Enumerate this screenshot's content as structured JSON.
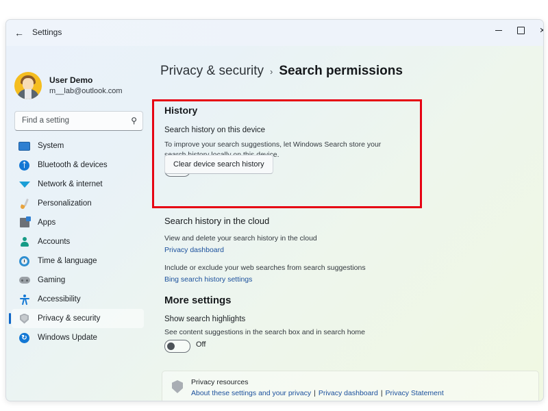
{
  "titlebar": {
    "back_icon": "back-arrow-icon",
    "title": "Settings",
    "minimize_label": "Minimize",
    "maximize_label": "Maximize",
    "close_label": "✕"
  },
  "account": {
    "name": "User Demo",
    "email": "m__lab@outlook.com",
    "avatar_icon": "user-avatar"
  },
  "search": {
    "placeholder": "Find a setting",
    "value": "",
    "icon": "search-icon"
  },
  "sidebar": {
    "items": [
      {
        "label": "System",
        "icon": "monitor-icon",
        "selected": false
      },
      {
        "label": "Bluetooth & devices",
        "icon": "bluetooth-icon",
        "selected": false
      },
      {
        "label": "Network & internet",
        "icon": "wifi-icon",
        "selected": false
      },
      {
        "label": "Personalization",
        "icon": "paintbrush-icon",
        "selected": false
      },
      {
        "label": "Apps",
        "icon": "apps-grid-icon",
        "selected": false
      },
      {
        "label": "Accounts",
        "icon": "person-icon",
        "selected": false
      },
      {
        "label": "Time & language",
        "icon": "clock-icon",
        "selected": false
      },
      {
        "label": "Gaming",
        "icon": "gamepad-icon",
        "selected": false
      },
      {
        "label": "Accessibility",
        "icon": "accessibility-icon",
        "selected": false
      },
      {
        "label": "Privacy & security",
        "icon": "shield-icon",
        "selected": true
      },
      {
        "label": "Windows Update",
        "icon": "update-icon",
        "selected": false
      }
    ]
  },
  "breadcrumb": {
    "parent": "Privacy & security",
    "separator": "›",
    "current": "Search permissions"
  },
  "history_section": {
    "heading": "History",
    "row_title": "Search history on this device",
    "row_description": "To improve your search suggestions, let Windows Search store your search history locally on this device.",
    "toggle_state": "Off",
    "clear_button": "Clear device search history",
    "highlight_color": "#e60012"
  },
  "cloud_section": {
    "heading": "Search history in the cloud",
    "description_1": "View and delete your search history in the cloud",
    "link_1": "Privacy dashboard",
    "description_2": "Include or exclude your web searches from search suggestions",
    "link_2": "Bing search history settings"
  },
  "more_settings": {
    "heading": "More settings",
    "row_title": "Show search highlights",
    "row_description": "See content suggestions in the search box and in search home",
    "toggle_state": "Off"
  },
  "privacy_card": {
    "icon": "shield-icon",
    "title": "Privacy resources",
    "link_1": "About these settings and your privacy",
    "link_2": "Privacy dashboard",
    "link_3": "Privacy Statement",
    "separator": "|"
  },
  "colors": {
    "accent": "#0f66c8",
    "link": "#1a4f9c",
    "highlight": "#e60012",
    "bg_top_left": "#eaf1fb",
    "bg_bottom_right": "#f0f8e2"
  }
}
